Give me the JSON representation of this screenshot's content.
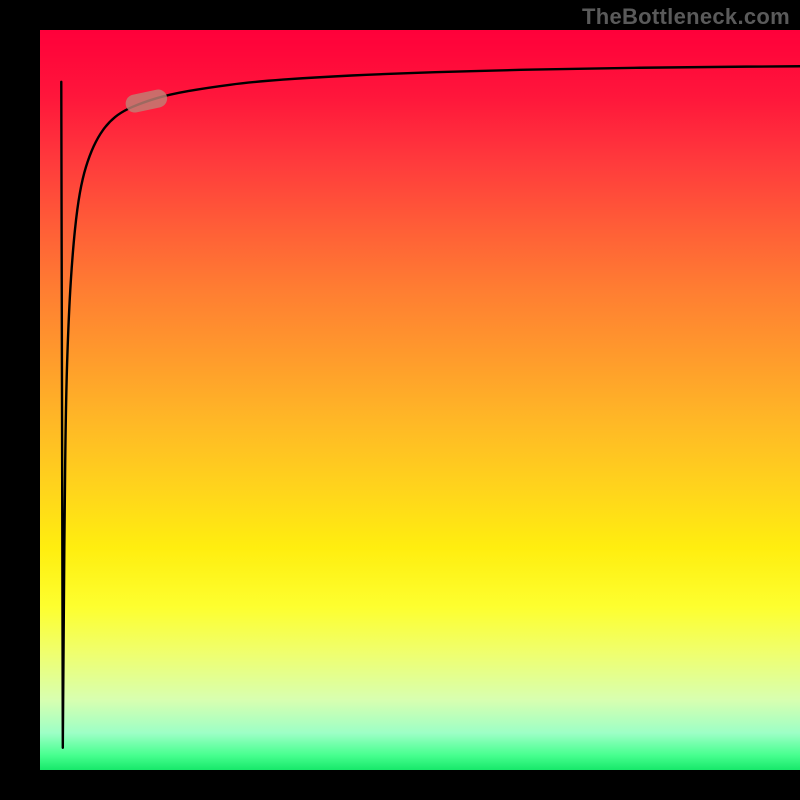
{
  "watermark": "TheBottleneck.com",
  "colors": {
    "frame": "#000000",
    "curve": "#000000",
    "marker": "#c08075",
    "gradient_stops": [
      "#ff003a",
      "#ff7d32",
      "#ffee0f",
      "#47ff8f",
      "#17e86a"
    ]
  },
  "chart_data": {
    "type": "line",
    "title": "",
    "xlabel": "",
    "ylabel": "",
    "xlim": [
      0,
      100
    ],
    "ylim": [
      0,
      100
    ],
    "x": [
      3.0,
      3.2,
      3.4,
      3.8,
      4.3,
      4.9,
      5.6,
      6.5,
      7.6,
      9.0,
      10.8,
      13.5,
      17,
      22,
      28,
      36,
      46,
      58,
      72,
      86,
      100
    ],
    "values": [
      3,
      30,
      50,
      62,
      70,
      76,
      80,
      83,
      85.5,
      87.5,
      89,
      90.2,
      91.3,
      92.2,
      93,
      93.6,
      94.1,
      94.5,
      94.8,
      95.0,
      95.1
    ],
    "annotations": [
      {
        "type": "marker",
        "x": 14,
        "y": 90.4
      }
    ]
  }
}
